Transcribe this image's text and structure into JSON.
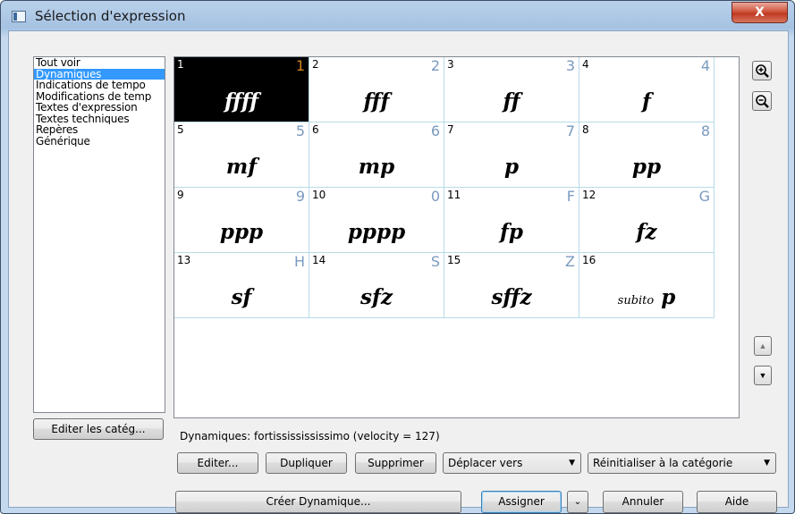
{
  "window": {
    "title": "Sélection d'expression",
    "close_glyph": "X"
  },
  "categories": {
    "items": [
      {
        "label": "Tout voir",
        "selected": false
      },
      {
        "label": "Dynamiques",
        "selected": true
      },
      {
        "label": "Indications de tempo",
        "selected": false
      },
      {
        "label": "Modifications de temp",
        "selected": false
      },
      {
        "label": "Textes d'expression",
        "selected": false
      },
      {
        "label": "Textes techniques",
        "selected": false
      },
      {
        "label": "Repères",
        "selected": false
      },
      {
        "label": "Générique",
        "selected": false
      }
    ]
  },
  "edit_categories_label": "Editer les catég...",
  "expressions": [
    {
      "num": "1",
      "key": "1",
      "symbol": "ffff",
      "selected": true
    },
    {
      "num": "2",
      "key": "2",
      "symbol": "fff"
    },
    {
      "num": "3",
      "key": "3",
      "symbol": "ff"
    },
    {
      "num": "4",
      "key": "4",
      "symbol": "f"
    },
    {
      "num": "5",
      "key": "5",
      "symbol": "mf"
    },
    {
      "num": "6",
      "key": "6",
      "symbol": "mp"
    },
    {
      "num": "7",
      "key": "7",
      "symbol": "p"
    },
    {
      "num": "8",
      "key": "8",
      "symbol": "pp"
    },
    {
      "num": "9",
      "key": "9",
      "symbol": "ppp"
    },
    {
      "num": "10",
      "key": "0",
      "symbol": "pppp"
    },
    {
      "num": "11",
      "key": "F",
      "symbol": "fp"
    },
    {
      "num": "12",
      "key": "G",
      "symbol": "fz"
    },
    {
      "num": "13",
      "key": "H",
      "symbol": "sf"
    },
    {
      "num": "14",
      "key": "S",
      "symbol": "sfz"
    },
    {
      "num": "15",
      "key": "Z",
      "symbol": "sffz"
    },
    {
      "num": "16",
      "key": "",
      "symbol_prefix": "subito",
      "symbol": "p"
    }
  ],
  "status_text": "Dynamiques: fortississississimo (velocity = 127)",
  "buttons": {
    "edit": "Editer...",
    "duplicate": "Dupliquer",
    "delete": "Supprimer",
    "move_to": "Déplacer vers",
    "reset_category": "Réinitialiser à la catégorie",
    "create": "Créer Dynamique...",
    "assign": "Assigner",
    "cancel": "Annuler",
    "help": "Aide"
  },
  "icons": {
    "zoom_in": "zoom-in-icon",
    "zoom_out": "zoom-out-icon",
    "scroll_up": "triangle-up-icon",
    "scroll_down": "triangle-down-icon"
  }
}
